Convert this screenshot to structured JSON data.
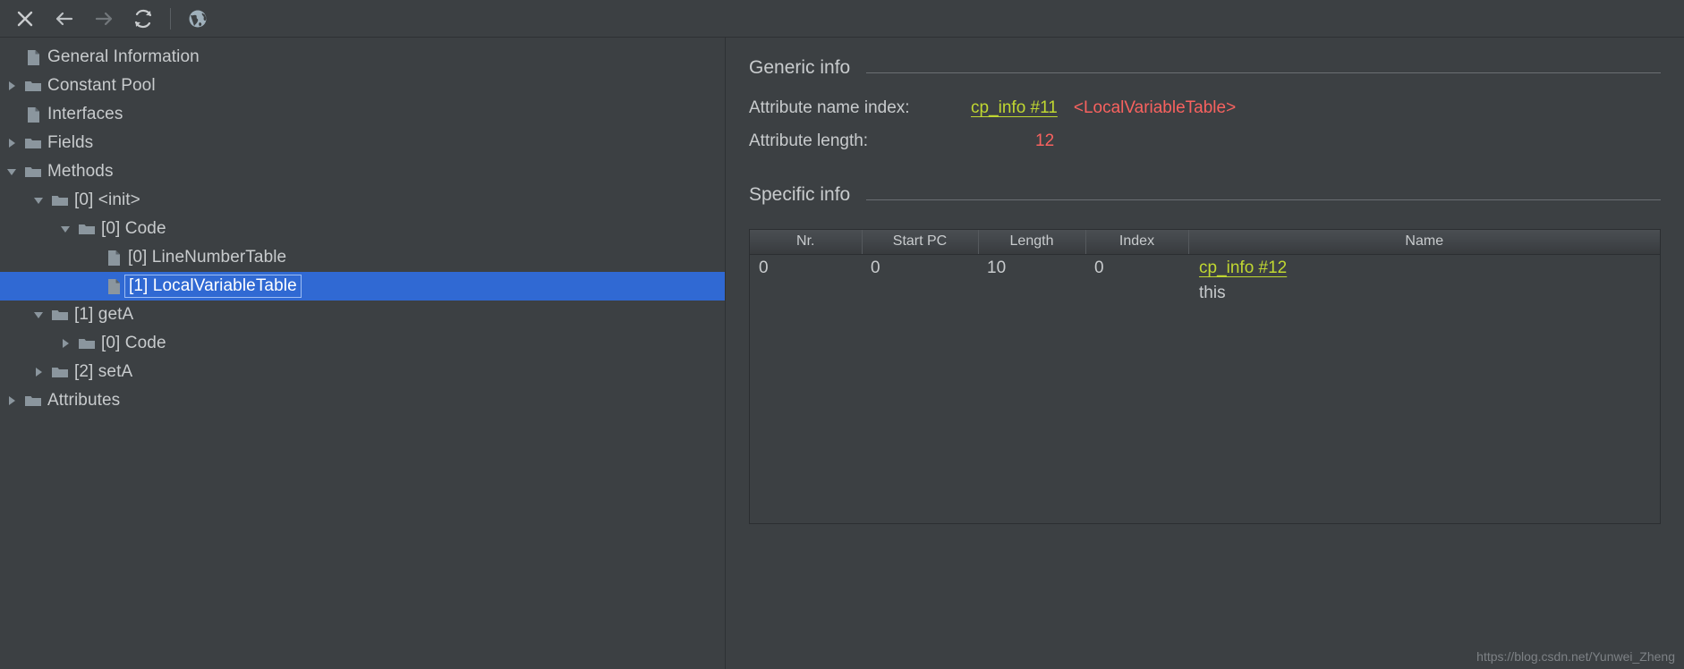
{
  "toolbar": {
    "buttons": [
      {
        "name": "close-icon",
        "label": "Close"
      },
      {
        "name": "back-arrow-icon",
        "label": "Back"
      },
      {
        "name": "forward-arrow-icon",
        "label": "Forward"
      },
      {
        "name": "reload-icon",
        "label": "Reload"
      },
      {
        "name": "browse-web-icon",
        "label": "Browse"
      }
    ]
  },
  "tree": {
    "nodes": [
      {
        "label": "General Information",
        "depth": 0,
        "icon": "file",
        "twisty": "none",
        "selected": false
      },
      {
        "label": "Constant Pool",
        "depth": 0,
        "icon": "folder",
        "twisty": "collapsed",
        "selected": false
      },
      {
        "label": "Interfaces",
        "depth": 0,
        "icon": "file",
        "twisty": "none",
        "selected": false
      },
      {
        "label": "Fields",
        "depth": 0,
        "icon": "folder",
        "twisty": "collapsed",
        "selected": false
      },
      {
        "label": "Methods",
        "depth": 0,
        "icon": "folder",
        "twisty": "expanded",
        "selected": false
      },
      {
        "label": "[0] <init>",
        "depth": 1,
        "icon": "folder",
        "twisty": "expanded",
        "selected": false
      },
      {
        "label": "[0] Code",
        "depth": 2,
        "icon": "folder",
        "twisty": "expanded",
        "selected": false
      },
      {
        "label": "[0] LineNumberTable",
        "depth": 3,
        "icon": "file",
        "twisty": "none",
        "selected": false
      },
      {
        "label": "[1] LocalVariableTable",
        "depth": 3,
        "icon": "file",
        "twisty": "none",
        "selected": true
      },
      {
        "label": "[1] getA",
        "depth": 1,
        "icon": "folder",
        "twisty": "expanded",
        "selected": false
      },
      {
        "label": "[0] Code",
        "depth": 2,
        "icon": "folder",
        "twisty": "collapsed",
        "selected": false
      },
      {
        "label": "[2] setA",
        "depth": 1,
        "icon": "folder",
        "twisty": "collapsed",
        "selected": false
      },
      {
        "label": "Attributes",
        "depth": 0,
        "icon": "folder",
        "twisty": "collapsed",
        "selected": false
      }
    ]
  },
  "detail": {
    "generic_info": {
      "title": "Generic info",
      "rows": [
        {
          "key": "Attribute name index:",
          "link": "cp_info #11",
          "annotation": "<LocalVariableTable>"
        },
        {
          "key": "Attribute length:",
          "value": "12"
        }
      ]
    },
    "specific_info": {
      "title": "Specific info",
      "table": {
        "columns": [
          "Nr.",
          "Start PC",
          "Length",
          "Index",
          "Name"
        ],
        "rows": [
          {
            "nr": "0",
            "start_pc": "0",
            "length": "10",
            "index": "0",
            "name_link": "cp_info #12",
            "name_sub": "this"
          }
        ]
      }
    }
  },
  "watermark": "https://blog.csdn.net/Yunwei_Zheng",
  "colors": {
    "background": "#3c4043",
    "selection": "#3069d3",
    "link": "#c0d731",
    "value_red": "#f8625f",
    "text": "#c8cbcd",
    "icon": "#8b969e"
  }
}
